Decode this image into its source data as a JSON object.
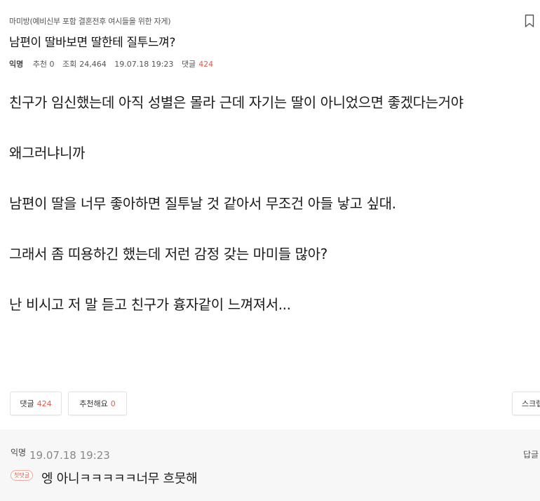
{
  "post": {
    "category": "마미방(예비신부 포함 결혼전후 여시들을 위한 자게)",
    "title": "남편이 딸바보면 딸한테 질투느껴?",
    "meta": {
      "author": "익명",
      "recommend": "추천 0",
      "views_label": "조회",
      "views": "24,464",
      "date": "19.07.18 19:23",
      "comments_label": "댓글",
      "comments": "424"
    },
    "body": [
      "친구가 임신했는데 아직 성별은 몰라 근데 자기는 딸이 아니었으면 좋겠다는거야",
      "왜그러냐니까",
      "남편이 딸을 너무 좋아하면 질투날 것 같아서 무조건 아들 낳고 싶대.",
      "그래서 좀 띠용하긴 했는데 저런 감정 갖는 마미들 많아?",
      "난 비시고 저 말 듣고 친구가 흉자같이 느껴져서..."
    ]
  },
  "actions": {
    "comment_label": "댓글",
    "comment_count": "424",
    "recommend_label": "추천해요",
    "recommend_count": "0",
    "scrap_label": "스크랩"
  },
  "comment": {
    "author": "익명",
    "date": "19.07.18 19:23",
    "reply_label": "답글",
    "badge": "첫댓글",
    "text": "엥 아니ㅋㅋㅋㅋㅋ너무 흐뭇해"
  },
  "icons": {
    "bookmark": "bookmark-icon"
  },
  "colors": {
    "accent": "#e35b4b",
    "comment_bg": "#f7f7f8"
  }
}
